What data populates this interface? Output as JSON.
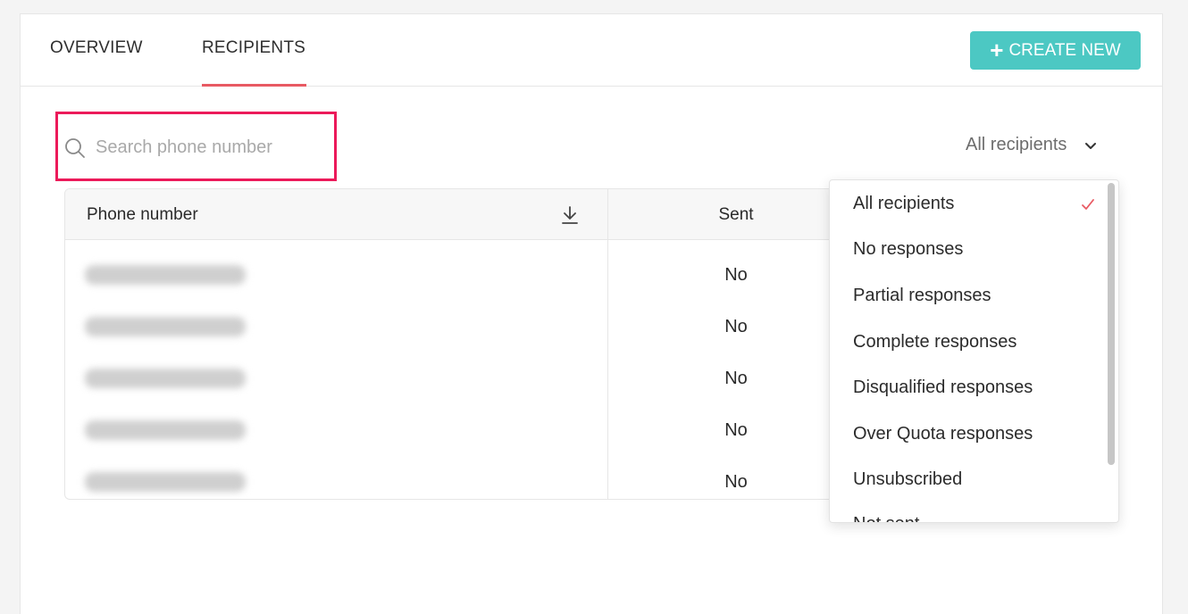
{
  "tabs": {
    "overview": "OVERVIEW",
    "recipients": "RECIPIENTS",
    "active": "recipients"
  },
  "create_button": {
    "icon": "plus-icon",
    "label": "CREATE NEW"
  },
  "search": {
    "placeholder": "Search phone number",
    "value": "",
    "icon": "search-icon"
  },
  "filter": {
    "selected": "All recipients",
    "icon": "chevron-down-icon"
  },
  "table": {
    "headers": {
      "phone": "Phone number",
      "sent": "Sent"
    },
    "download_icon": "download-icon",
    "rows": [
      {
        "phone": "",
        "sent": "No"
      },
      {
        "phone": "",
        "sent": "No"
      },
      {
        "phone": "",
        "sent": "No"
      },
      {
        "phone": "",
        "sent": "No"
      },
      {
        "phone": "",
        "sent": "No"
      }
    ]
  },
  "dropdown": {
    "items": [
      "All recipients",
      "No responses",
      "Partial responses",
      "Complete responses",
      "Disqualified responses",
      "Over Quota responses",
      "Unsubscribed",
      "Not sent"
    ],
    "selected_index": 0,
    "check_icon": "check-icon"
  },
  "colors": {
    "accent": "#4cc8c3",
    "tab_underline": "#e85a63",
    "highlight_border": "#ec1a5a",
    "check": "#e85a63"
  }
}
